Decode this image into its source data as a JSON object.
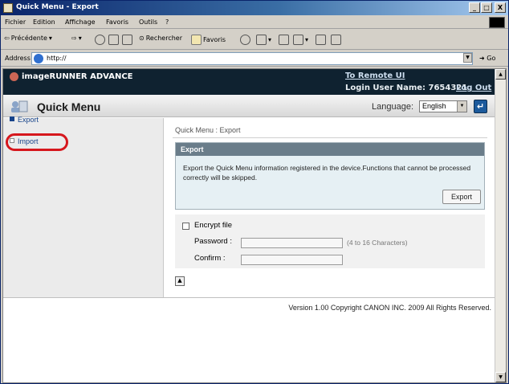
{
  "window": {
    "title": "Quick Menu - Export",
    "minimize": "_",
    "maximize": "□",
    "close": "X"
  },
  "menu": [
    "Fichier",
    "Edition",
    "Affichage",
    "Favoris",
    "Outils",
    "?"
  ],
  "toolbar": {
    "back": "Précédente",
    "search": "Rechercher",
    "favorites": "Favoris"
  },
  "address": {
    "label": "Address",
    "url": "http://",
    "go": "Go"
  },
  "header": {
    "brand": "imageRUNNER ADVANCE",
    "remote_ui": "To Remote UI",
    "login_user": "Login User Name: 7654321",
    "logout": "Log Out"
  },
  "quickmenu": {
    "title": "Quick Menu",
    "language_label": "Language:",
    "language_value": "English"
  },
  "sidebar": {
    "items": [
      {
        "label": "Export",
        "active": true
      },
      {
        "label": "Import",
        "active": false
      }
    ]
  },
  "main": {
    "breadcrumb": "Quick Menu : Export",
    "export": {
      "heading": "Export",
      "description": "Export the Quick Menu information registered in the device.Functions that cannot be processed correctly will be skipped.",
      "button": "Export"
    },
    "encrypt": {
      "checkbox_label": "Encrypt file",
      "password_label": "Password :",
      "confirm_label": "Confirm :",
      "hint": "(4 to 16 Characters)",
      "password_value": "",
      "confirm_value": ""
    }
  },
  "footer": "Version 1.00 Copyright CANON INC. 2009 All Rights Reserved.",
  "colors": {
    "header_bg": "#0f2230",
    "highlight_circle": "#d6171d",
    "link": "#16438a"
  }
}
